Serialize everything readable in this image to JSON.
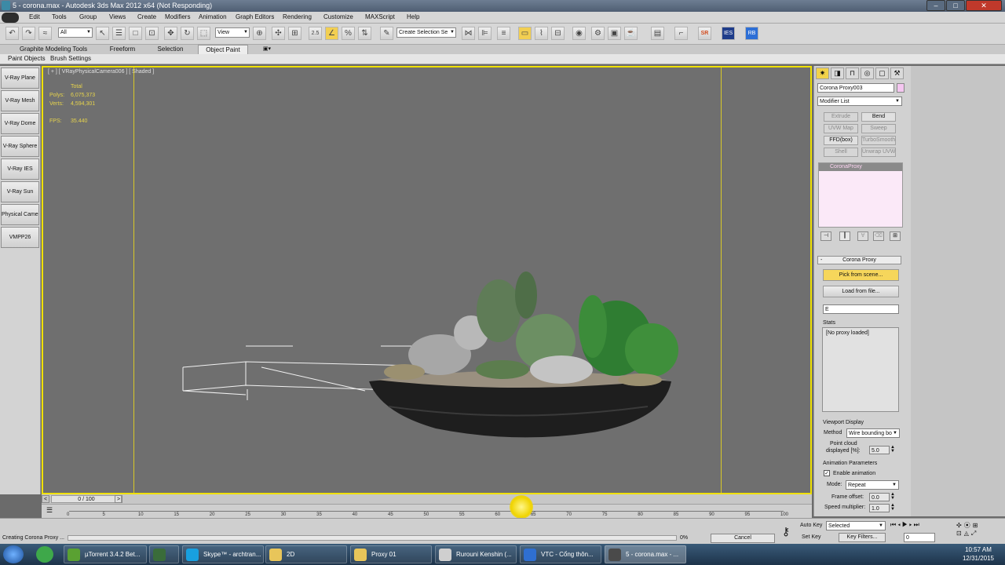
{
  "window": {
    "title": "5 - corona.max - Autodesk 3ds Max  2012 x64    (Not Responding)",
    "minimize": "–",
    "maximize": "□",
    "close": "✕"
  },
  "menubar": {
    "items": [
      "Edit",
      "Tools",
      "Group",
      "Views",
      "Create",
      "Modifiers",
      "Animation",
      "Graph Editors",
      "Rendering",
      "Customize",
      "MAXScript",
      "Help"
    ]
  },
  "toolbar": {
    "filter_value": "All",
    "refcoord_value": "View",
    "selection_set_placeholder": "Create Selection Se",
    "snap_label": "2.5",
    "sr_label": "SR",
    "ies_label": "IES",
    "rb_label": "RB"
  },
  "ribbon": {
    "tabs": [
      "Graphite Modeling Tools",
      "Freeform",
      "Selection",
      "Object Paint"
    ],
    "active_tab": "Object Paint",
    "subtabs": [
      "Paint Objects",
      "Brush Settings"
    ]
  },
  "left_panel": {
    "buttons": [
      "V-Ray Plane",
      "V-Ray Mesh",
      "V-Ray Dome",
      "V-Ray Sphere",
      "V-Ray IES",
      "V-Ray Sun",
      "Physical Camer",
      "VMPP26"
    ]
  },
  "viewport": {
    "label": "[ + ] [ VRayPhysicalCamera006 ] [ Shaded ]",
    "stats": {
      "total_label": "Total",
      "polys_label": "Polys:",
      "polys_value": "6,075,373",
      "verts_label": "Verts:",
      "verts_value": "4,594,301",
      "fps_label": "FPS:",
      "fps_value": "35.440"
    }
  },
  "command_panel": {
    "object_name": "Corona Proxy003",
    "object_color": "#f4c6f0",
    "modifier_list": "Modifier List",
    "modifier_buttons": [
      {
        "label": "Extrude",
        "enabled": false
      },
      {
        "label": "Bend",
        "enabled": true
      },
      {
        "label": "UVW Map",
        "enabled": false
      },
      {
        "label": "Sweep",
        "enabled": false
      },
      {
        "label": "FFD(box)",
        "enabled": true
      },
      {
        "label": "TurboSmooth",
        "enabled": false
      },
      {
        "label": "Shell",
        "enabled": false
      },
      {
        "label": "Unwrap UVW",
        "enabled": false
      }
    ],
    "stack_item": "CoronaProxy",
    "rollout_title": "Corona Proxy",
    "rollout_collapse": "-",
    "pick_from_scene": "Pick from scene...",
    "load_from_file": "Load from file...",
    "file_field": "E",
    "stats_label": "Stats",
    "stats_text": "[No proxy loaded]",
    "viewport_display_label": "Viewport Display",
    "method_label": "Method",
    "method_value": "Wire bounding bo",
    "point_cloud_label_1": "Point cloud",
    "point_cloud_label_2": "displayed [%]:",
    "point_cloud_value": "5.0",
    "anim_params_label": "Animation Parameters",
    "enable_animation": "Enable animation",
    "enable_animation_checked": true,
    "mode_label": "Mode:",
    "mode_value": "Repeat",
    "frame_offset_label": "Frame offset:",
    "frame_offset_value": "0.0",
    "speed_mult_label": "Speed multiplier:",
    "speed_mult_value": "1.0"
  },
  "timeline": {
    "frame_counter": "0 / 100",
    "ticks": [
      "0",
      "5",
      "10",
      "15",
      "20",
      "25",
      "30",
      "35",
      "40",
      "45",
      "50",
      "55",
      "60",
      "65",
      "70",
      "75",
      "80",
      "85",
      "90",
      "95",
      "100"
    ]
  },
  "statusbar": {
    "message": "Creating Corona Proxy ...",
    "progress": "0%",
    "cancel": "Cancel",
    "auto_key": "Auto Key",
    "set_key": "Set Key",
    "selected_value": "Selected",
    "key_filters": "Key Filters...",
    "frame_value": "0"
  },
  "taskbar": {
    "tasks": [
      {
        "label": "µTorrent 3.4.2 Bet...",
        "color": "#5aa132",
        "active": false
      },
      {
        "label": "",
        "color": "#3a6c3a",
        "active": false
      },
      {
        "label": "Skype™ - archtran...",
        "color": "#18a0e0",
        "active": false
      },
      {
        "label": "2D",
        "color": "#e8c55a",
        "active": false
      },
      {
        "label": "Proxy 01",
        "color": "#e8c55a",
        "active": false
      },
      {
        "label": "Rurouni Kenshin (...",
        "color": "#cfcfcf",
        "active": false
      },
      {
        "label": "VTC - Cổng thôn...",
        "color": "#2f6fd1",
        "active": false
      },
      {
        "label": "5 - corona.max - ...",
        "color": "#4a4a4a",
        "active": true
      }
    ],
    "time": "10:57 AM",
    "date": "12/31/2015"
  }
}
